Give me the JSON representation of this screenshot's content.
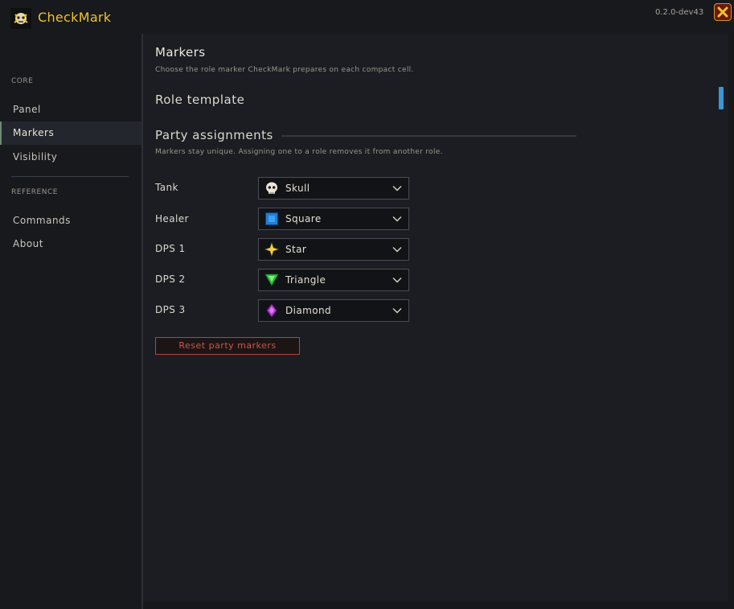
{
  "app": {
    "title": "CheckMark",
    "version": "0.2.0-dev43"
  },
  "sidebar": {
    "sections": [
      {
        "header": "CORE",
        "items": [
          "Panel",
          "Markers",
          "Visibility"
        ]
      },
      {
        "header": "REFERENCE",
        "items": [
          "Commands",
          "About"
        ]
      }
    ],
    "active_item": "Markers"
  },
  "page": {
    "title": "Markers",
    "subtitle": "Choose the role marker CheckMark prepares on each compact cell.",
    "role_template_title": "Role template",
    "party_title": "Party assignments",
    "party_note": "Markers stay unique. Assigning one to a role removes it from another role.",
    "assignments": [
      {
        "role": "Tank",
        "marker": "Skull",
        "icon": "skull-icon"
      },
      {
        "role": "Healer",
        "marker": "Square",
        "icon": "square-icon"
      },
      {
        "role": "DPS 1",
        "marker": "Star",
        "icon": "star-icon"
      },
      {
        "role": "DPS 2",
        "marker": "Triangle",
        "icon": "triangle-icon"
      },
      {
        "role": "DPS 3",
        "marker": "Diamond",
        "icon": "diamond-icon"
      }
    ],
    "reset_label": "Reset party markers"
  },
  "colors": {
    "accent_gold": "#f2c12e",
    "scroll_thumb": "#3b95d6",
    "danger": "#c8564d"
  }
}
